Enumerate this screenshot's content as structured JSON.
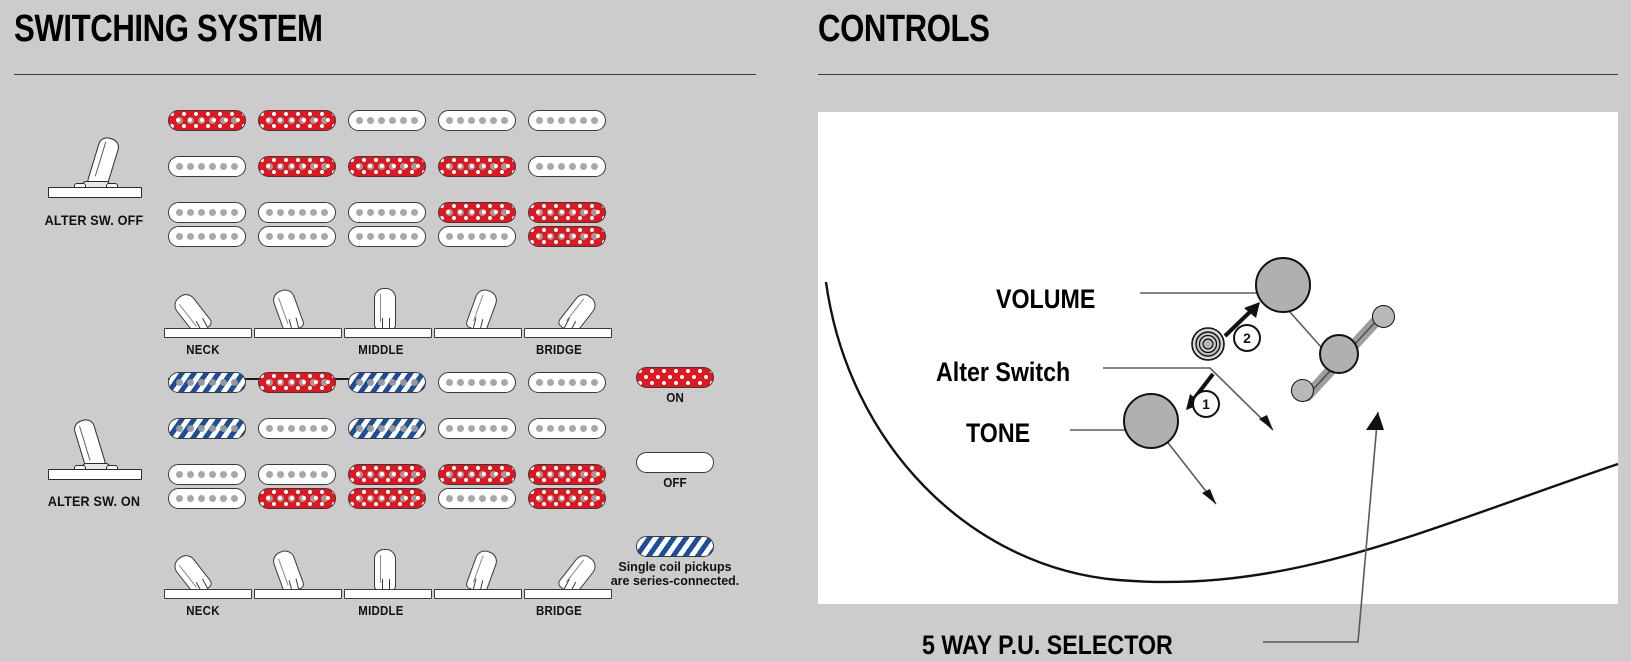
{
  "panels": {
    "switching": {
      "title": "SWITCHING SYSTEM"
    },
    "controls": {
      "title": "CONTROLS"
    }
  },
  "switching": {
    "alter_off": {
      "toggle_label": "ALTER SW. OFF",
      "position_labels": [
        "NECK",
        "",
        "MIDDLE",
        "",
        "BRIDGE"
      ],
      "rows": [
        {
          "name": "neck-single",
          "type": "single",
          "states": [
            "on",
            "on",
            "off",
            "off",
            "off"
          ]
        },
        {
          "name": "middle-single",
          "type": "single",
          "states": [
            "off",
            "on",
            "on",
            "on",
            "off"
          ]
        },
        {
          "name": "bridge-hb",
          "type": "humbucker",
          "states": [
            [
              "off",
              "off"
            ],
            [
              "off",
              "off"
            ],
            [
              "off",
              "off"
            ],
            [
              "on",
              "off"
            ],
            [
              "on",
              "on"
            ]
          ]
        }
      ]
    },
    "alter_on": {
      "toggle_label": "ALTER SW. ON",
      "position_labels": [
        "NECK",
        "",
        "MIDDLE",
        "",
        "BRIDGE"
      ],
      "rows": [
        {
          "name": "neck-single",
          "type": "single",
          "states": [
            "series",
            "on",
            "series",
            "off",
            "off"
          ]
        },
        {
          "name": "middle-single",
          "type": "single",
          "states": [
            "series",
            "off",
            "series",
            "off",
            "off"
          ]
        },
        {
          "name": "bridge-hb",
          "type": "humbucker",
          "states": [
            [
              "off",
              "off"
            ],
            [
              "off",
              "on"
            ],
            [
              "on",
              "on"
            ],
            [
              "on",
              "off"
            ],
            [
              "on",
              "on"
            ]
          ]
        }
      ]
    },
    "legend": {
      "on_label": "ON",
      "off_label": "OFF",
      "series_note_line1": "Single coil pickups",
      "series_note_line2": "are series-connected."
    }
  },
  "controls": {
    "labels": {
      "volume": "VOLUME",
      "alter_switch": "Alter Switch",
      "tone": "TONE",
      "selector": "5 WAY P.U. SELECTOR"
    },
    "callouts": {
      "one": "1",
      "two": "2"
    }
  },
  "colors": {
    "background": "#cccccc",
    "pickup_on": "#e2161f",
    "pickup_off": "#ffffff",
    "pickup_series": "#1b4f9c",
    "pole": "#a8a8a8",
    "outline": "#3a3a3a",
    "knob": "#b0b0b0",
    "canvas": "#ffffff"
  }
}
